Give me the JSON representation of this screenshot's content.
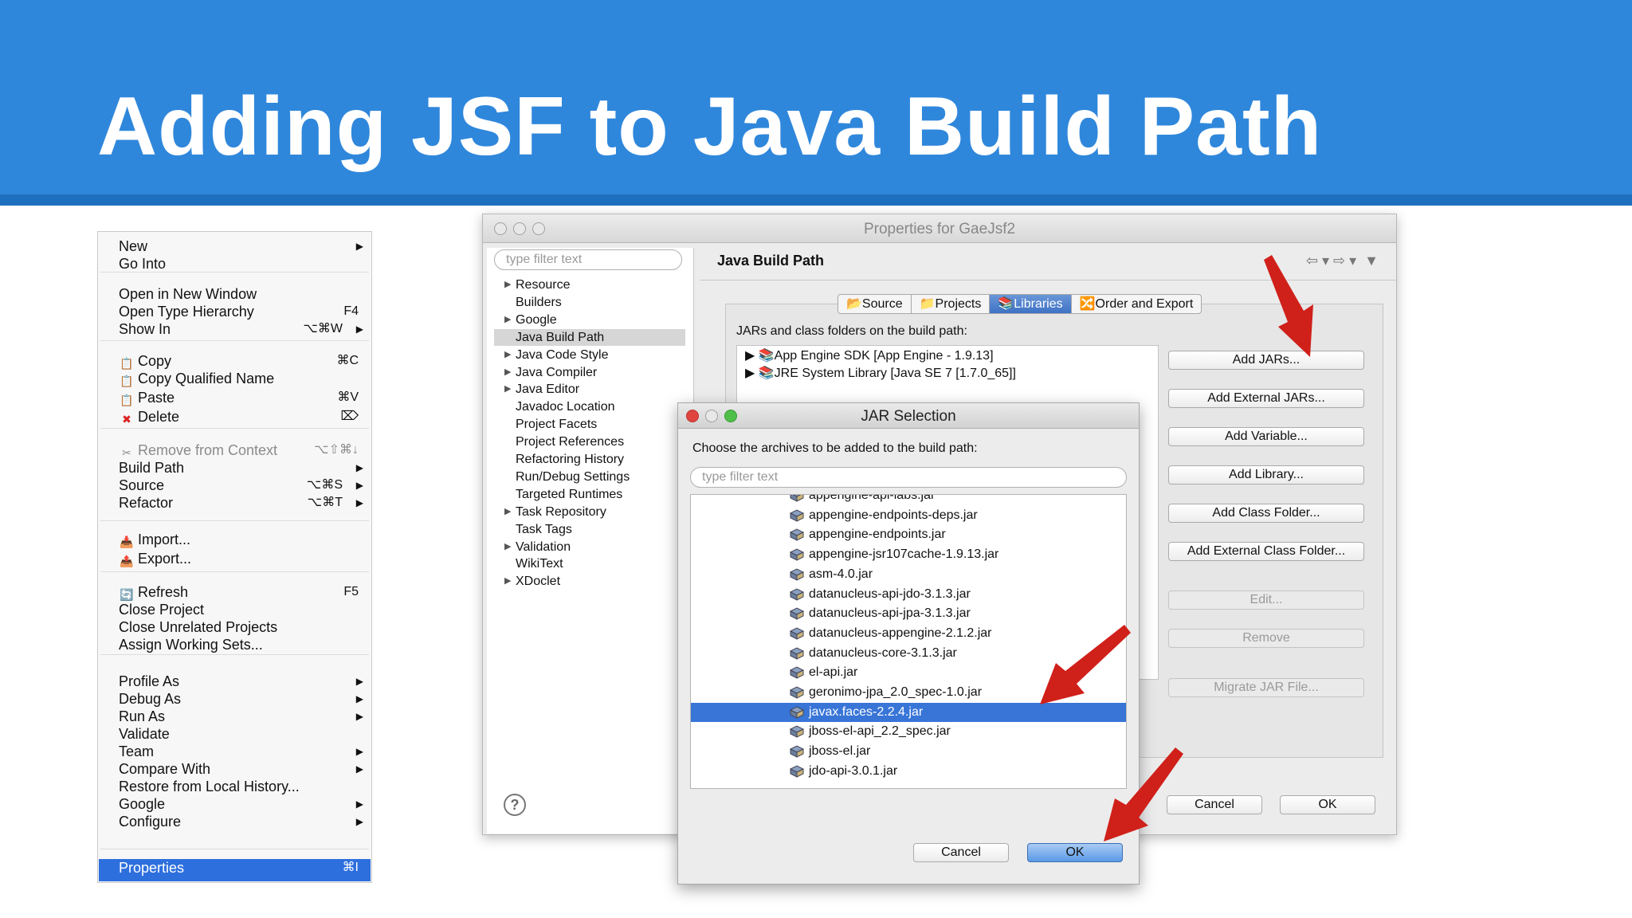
{
  "slide": {
    "title": "Adding JSF to Java Build Path"
  },
  "context_menu": {
    "items": [
      {
        "label": "New",
        "shortcut": "",
        "submenu": true
      },
      {
        "label": "Go Into",
        "shortcut": "",
        "submenu": false
      },
      {
        "label": "Open in New Window",
        "shortcut": "",
        "submenu": false
      },
      {
        "label": "Open Type Hierarchy",
        "shortcut": "F4",
        "submenu": false
      },
      {
        "label": "Show In",
        "shortcut": "⌥⌘W",
        "submenu": true
      },
      {
        "label": "Copy",
        "shortcut": "⌘C",
        "submenu": false
      },
      {
        "label": "Copy Qualified Name",
        "shortcut": "",
        "submenu": false
      },
      {
        "label": "Paste",
        "shortcut": "⌘V",
        "submenu": false
      },
      {
        "label": "Delete",
        "shortcut": "⌦",
        "submenu": false
      },
      {
        "label": "Remove from Context",
        "shortcut": "⌥⇧⌘↓",
        "submenu": false
      },
      {
        "label": "Build Path",
        "shortcut": "",
        "submenu": true
      },
      {
        "label": "Source",
        "shortcut": "⌥⌘S",
        "submenu": true
      },
      {
        "label": "Refactor",
        "shortcut": "⌥⌘T",
        "submenu": true
      },
      {
        "label": "Import...",
        "shortcut": "",
        "submenu": false
      },
      {
        "label": "Export...",
        "shortcut": "",
        "submenu": false
      },
      {
        "label": "Refresh",
        "shortcut": "F5",
        "submenu": false
      },
      {
        "label": "Close Project",
        "shortcut": "",
        "submenu": false
      },
      {
        "label": "Close Unrelated Projects",
        "shortcut": "",
        "submenu": false
      },
      {
        "label": "Assign Working Sets...",
        "shortcut": "",
        "submenu": false
      },
      {
        "label": "Profile As",
        "shortcut": "",
        "submenu": true
      },
      {
        "label": "Debug As",
        "shortcut": "",
        "submenu": true
      },
      {
        "label": "Run As",
        "shortcut": "",
        "submenu": true
      },
      {
        "label": "Validate",
        "shortcut": "",
        "submenu": false
      },
      {
        "label": "Team",
        "shortcut": "",
        "submenu": true
      },
      {
        "label": "Compare With",
        "shortcut": "",
        "submenu": true
      },
      {
        "label": "Restore from Local History...",
        "shortcut": "",
        "submenu": false
      },
      {
        "label": "Google",
        "shortcut": "",
        "submenu": true
      },
      {
        "label": "Configure",
        "shortcut": "",
        "submenu": true
      },
      {
        "label": "Properties",
        "shortcut": "⌘I",
        "submenu": false
      }
    ]
  },
  "properties_dialog": {
    "title": "Properties for GaeJsf2",
    "filter_placeholder": "type filter text",
    "tree": [
      {
        "label": "Resource",
        "expandable": true
      },
      {
        "label": "Builders",
        "expandable": false
      },
      {
        "label": "Google",
        "expandable": true
      },
      {
        "label": "Java Build Path",
        "expandable": false
      },
      {
        "label": "Java Code Style",
        "expandable": true
      },
      {
        "label": "Java Compiler",
        "expandable": true
      },
      {
        "label": "Java Editor",
        "expandable": true
      },
      {
        "label": "Javadoc Location",
        "expandable": false
      },
      {
        "label": "Project Facets",
        "expandable": false
      },
      {
        "label": "Project References",
        "expandable": false
      },
      {
        "label": "Refactoring History",
        "expandable": false
      },
      {
        "label": "Run/Debug Settings",
        "expandable": false
      },
      {
        "label": "Targeted Runtimes",
        "expandable": false
      },
      {
        "label": "Task Repository",
        "expandable": true
      },
      {
        "label": "Task Tags",
        "expandable": false
      },
      {
        "label": "Validation",
        "expandable": true
      },
      {
        "label": "WikiText",
        "expandable": false
      },
      {
        "label": "XDoclet",
        "expandable": true
      }
    ],
    "page_title": "Java Build Path",
    "tabs": [
      "Source",
      "Projects",
      "Libraries",
      "Order and Export"
    ],
    "active_tab": "Libraries",
    "list_label": "JARs and class folders on the build path:",
    "libraries": [
      "App Engine SDK [App Engine - 1.9.13]",
      "JRE System Library [Java SE 7 [1.7.0_65]]"
    ],
    "buttons": {
      "add_jars": "Add JARs...",
      "add_external_jars": "Add External JARs...",
      "add_variable": "Add Variable...",
      "add_library": "Add Library...",
      "add_class_folder": "Add Class Folder...",
      "add_external_class_folder": "Add External Class Folder...",
      "edit": "Edit...",
      "remove": "Remove",
      "migrate": "Migrate JAR File...",
      "cancel": "Cancel",
      "ok": "OK"
    }
  },
  "jar_dialog": {
    "title": "JAR Selection",
    "prompt": "Choose the archives to be added to the build path:",
    "filter_placeholder": "type filter text",
    "files": [
      "appengine-api-labs.jar",
      "appengine-endpoints-deps.jar",
      "appengine-endpoints.jar",
      "appengine-jsr107cache-1.9.13.jar",
      "asm-4.0.jar",
      "datanucleus-api-jdo-3.1.3.jar",
      "datanucleus-api-jpa-3.1.3.jar",
      "datanucleus-appengine-2.1.2.jar",
      "datanucleus-core-3.1.3.jar",
      "el-api.jar",
      "geronimo-jpa_2.0_spec-1.0.jar",
      "javax.faces-2.2.4.jar",
      "jboss-el-api_2.2_spec.jar",
      "jboss-el.jar",
      "jdo-api-3.0.1.jar"
    ],
    "selected": "javax.faces-2.2.4.jar",
    "cancel": "Cancel",
    "ok": "OK"
  },
  "colors": {
    "banner": "#2f87db",
    "selection": "#3875d7",
    "arrow": "#d0201a"
  }
}
